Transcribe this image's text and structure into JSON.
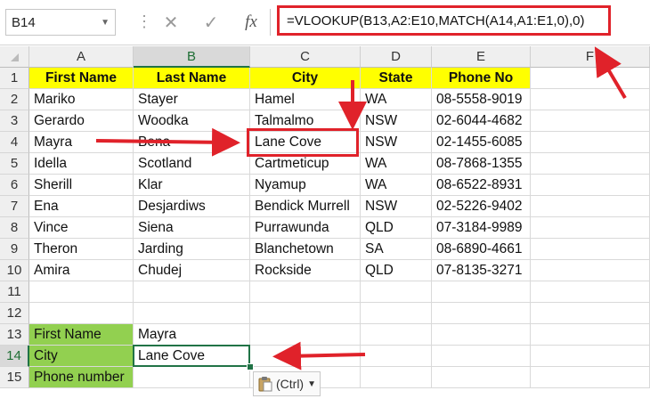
{
  "formula_bar": {
    "name_box": "B14",
    "formula": "=VLOOKUP(B13,A2:E10,MATCH(A14,A1:E1,0),0)",
    "cancel_icon": "close-icon",
    "enter_icon": "check-icon",
    "fx_label": "fx"
  },
  "columns": [
    "A",
    "B",
    "C",
    "D",
    "E",
    "F"
  ],
  "rows": [
    "1",
    "2",
    "3",
    "4",
    "5",
    "6",
    "7",
    "8",
    "9",
    "10",
    "11",
    "12",
    "13",
    "14",
    "15"
  ],
  "headers": [
    "First Name",
    "Last Name",
    "City",
    "State",
    "Phone No"
  ],
  "table": [
    [
      "Mariko",
      "Stayer",
      "Hamel",
      "WA",
      "08-5558-9019"
    ],
    [
      "Gerardo",
      "Woodka",
      "Talmalmo",
      "NSW",
      "02-6044-4682"
    ],
    [
      "Mayra",
      "Bena",
      "Lane Cove",
      "NSW",
      "02-1455-6085"
    ],
    [
      "Idella",
      "Scotland",
      "Cartmeticup",
      "WA",
      "08-7868-1355"
    ],
    [
      "Sherill",
      "Klar",
      "Nyamup",
      "WA",
      "08-6522-8931"
    ],
    [
      "Ena",
      "Desjardiws",
      "Bendick Murrell",
      "NSW",
      "02-5226-9402"
    ],
    [
      "Vince",
      "Siena",
      "Purrawunda",
      "QLD",
      "07-3184-9989"
    ],
    [
      "Theron",
      "Jarding",
      "Blanchetown",
      "SA",
      "08-6890-4661"
    ],
    [
      "Amira",
      "Chudej",
      "Rockside",
      "QLD",
      "07-8135-3271"
    ]
  ],
  "lookup": {
    "labels": [
      "First Name",
      "City",
      "Phone number"
    ],
    "values": [
      "Mayra",
      "Lane Cove",
      ""
    ]
  },
  "paste_options": {
    "label": "(Ctrl)",
    "icon": "clipboard-icon"
  },
  "colors": {
    "header_fill": "#ffff00",
    "label_fill": "#92d050",
    "annotation": "#e0222a",
    "excel_green": "#217346"
  }
}
